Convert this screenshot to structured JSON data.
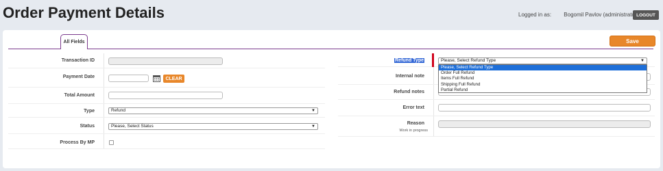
{
  "header": {
    "title": "Order Payment Details",
    "logged_in_label": "Logged in as:",
    "user": "Bogomil Pavlov (administrator)",
    "logout_label": "LOGOUT"
  },
  "tabs": [
    {
      "label": "All Fields"
    }
  ],
  "toolbar": {
    "save_label": "Save"
  },
  "left_fields": {
    "transaction_id": {
      "label": "Transaction ID",
      "value": ""
    },
    "payment_date": {
      "label": "Payment Date",
      "value": "",
      "clear_label": "CLEAR"
    },
    "total_amount": {
      "label": "Total Amount",
      "value": ""
    },
    "type": {
      "label": "Type",
      "value": "Refund"
    },
    "status": {
      "label": "Status",
      "value": "Please, Select Status"
    },
    "process_by_mp": {
      "label": "Process By MP",
      "checked": false
    }
  },
  "right_fields": {
    "refund_type": {
      "label": "Refund Type",
      "value": "Please, Select Refund Type"
    },
    "internal_note": {
      "label": "Internal note",
      "value": ""
    },
    "refund_notes": {
      "label": "Refund notes",
      "value": ""
    },
    "error_text": {
      "label": "Error text",
      "value": ""
    },
    "reason": {
      "label": "Reason",
      "sublabel": "Work in progress",
      "value": ""
    }
  },
  "refund_type_dropdown": {
    "options": [
      "Please, Select Refund Type",
      "Order Full Refund",
      "Items Full Refund",
      "Shipping Full Refund",
      "Partial Refund"
    ],
    "selected_index": 0
  },
  "colors": {
    "accent": "#e8872a",
    "tab_border": "#7b3a8c",
    "required": "#d0021b",
    "selection": "#1e6fd9"
  }
}
